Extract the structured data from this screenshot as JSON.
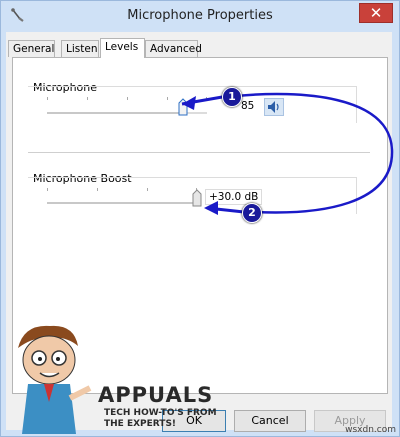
{
  "window": {
    "title": "Microphone Properties",
    "close_label": "✕"
  },
  "tabs": [
    {
      "label": "General",
      "active": false
    },
    {
      "label": "Listen",
      "active": false
    },
    {
      "label": "Levels",
      "active": true
    },
    {
      "label": "Advanced",
      "active": false
    }
  ],
  "microphone": {
    "label": "Microphone",
    "value": "85",
    "level_percent": 85,
    "speaker_icon": "speaker-icon"
  },
  "boost": {
    "label": "Microphone Boost",
    "value": "+30.0 dB",
    "level_percent": 100
  },
  "buttons": {
    "ok": "OK",
    "cancel": "Cancel",
    "apply": "Apply"
  },
  "callouts": {
    "one": "1",
    "two": "2",
    "arrow_color": "#1a1ac8"
  },
  "watermark": {
    "brand": "APPUALS",
    "tagline_1": "TECH HOW-TO'S FROM",
    "tagline_2": "THE EXPERTS!",
    "site": "wsxdn.com"
  }
}
